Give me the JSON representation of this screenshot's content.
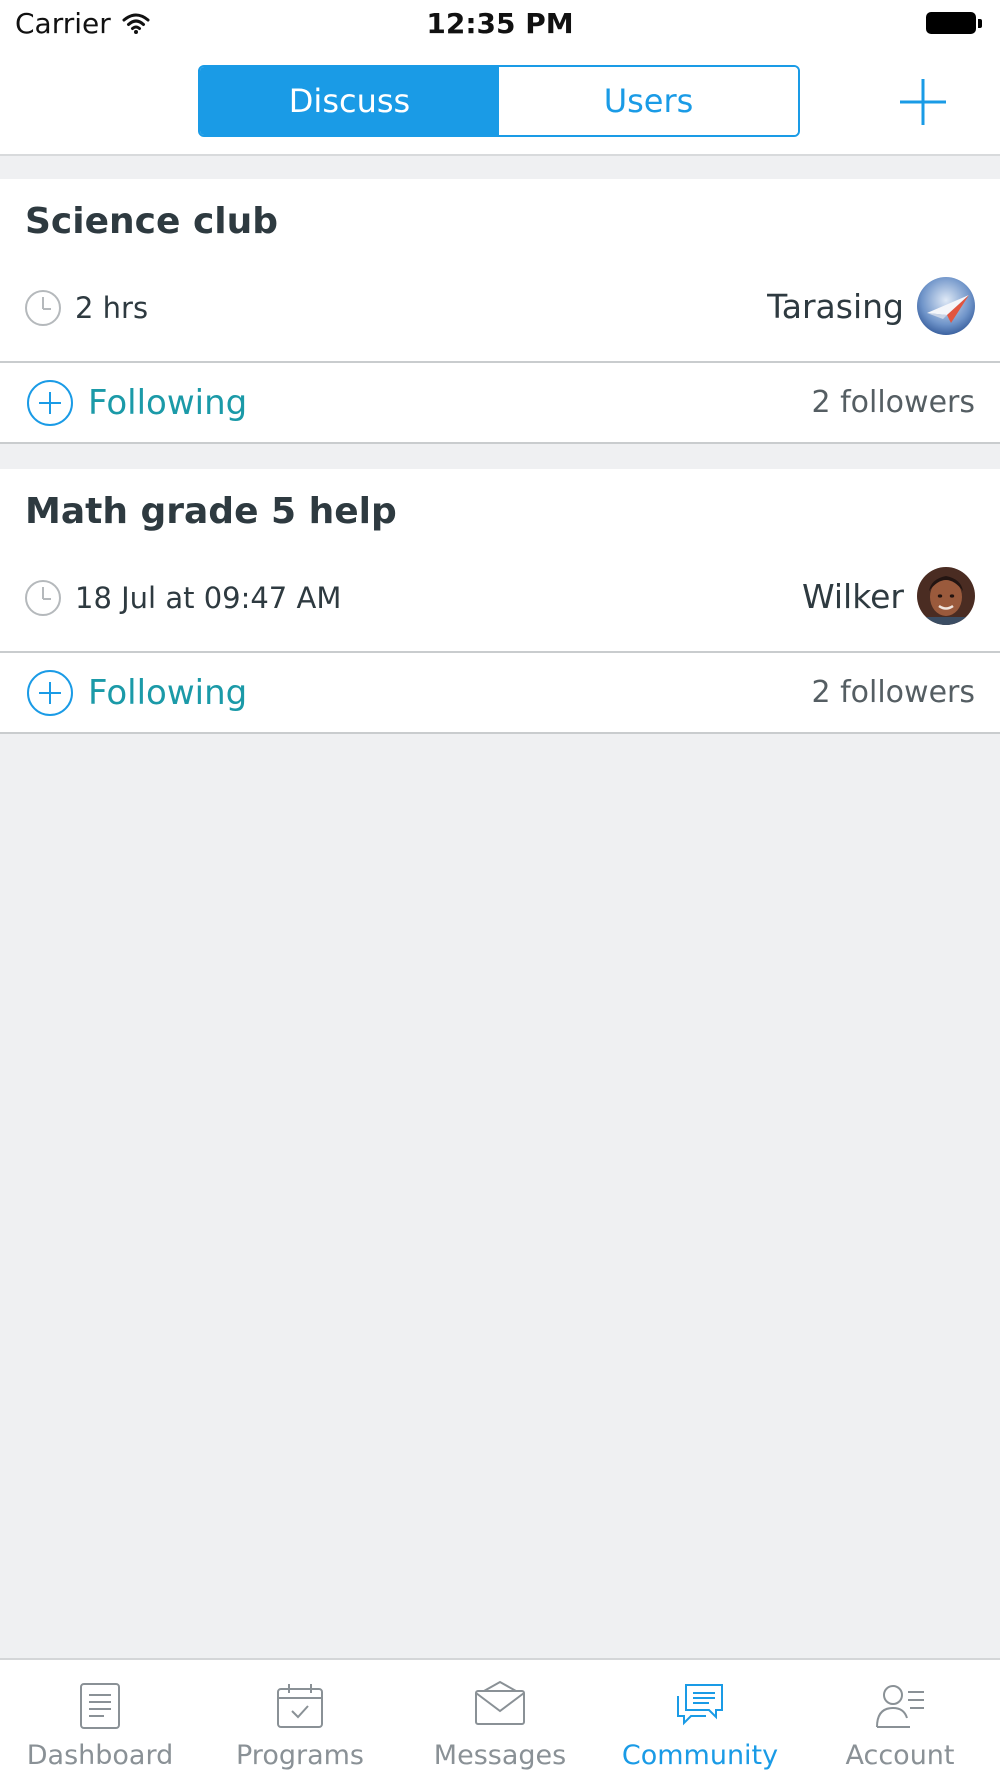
{
  "status_bar": {
    "carrier": "Carrier",
    "time": "12:35 PM"
  },
  "nav": {
    "segments": [
      {
        "label": "Discuss",
        "active": true
      },
      {
        "label": "Users",
        "active": false
      }
    ],
    "add_icon": "plus-icon"
  },
  "posts": [
    {
      "title": "Science club",
      "time": "2 hrs",
      "author": "Tarasing",
      "follow_label": "Following",
      "followers": "2 followers"
    },
    {
      "title": "Math grade 5 help",
      "time": "18 Jul at 09:47 AM",
      "author": "Wilker",
      "follow_label": "Following",
      "followers": "2 followers"
    }
  ],
  "tabs": [
    {
      "label": "Dashboard",
      "icon": "dashboard-icon",
      "active": false
    },
    {
      "label": "Programs",
      "icon": "calendar-icon",
      "active": false
    },
    {
      "label": "Messages",
      "icon": "envelope-icon",
      "active": false
    },
    {
      "label": "Community",
      "icon": "chat-bubbles-icon",
      "active": true
    },
    {
      "label": "Account",
      "icon": "user-list-icon",
      "active": false
    }
  ],
  "colors": {
    "accent": "#1a9be6",
    "follow_teal": "#1b9aa8",
    "background": "#eff0f2",
    "text_dark": "#2e3a40",
    "tab_inactive": "#8a9196"
  }
}
